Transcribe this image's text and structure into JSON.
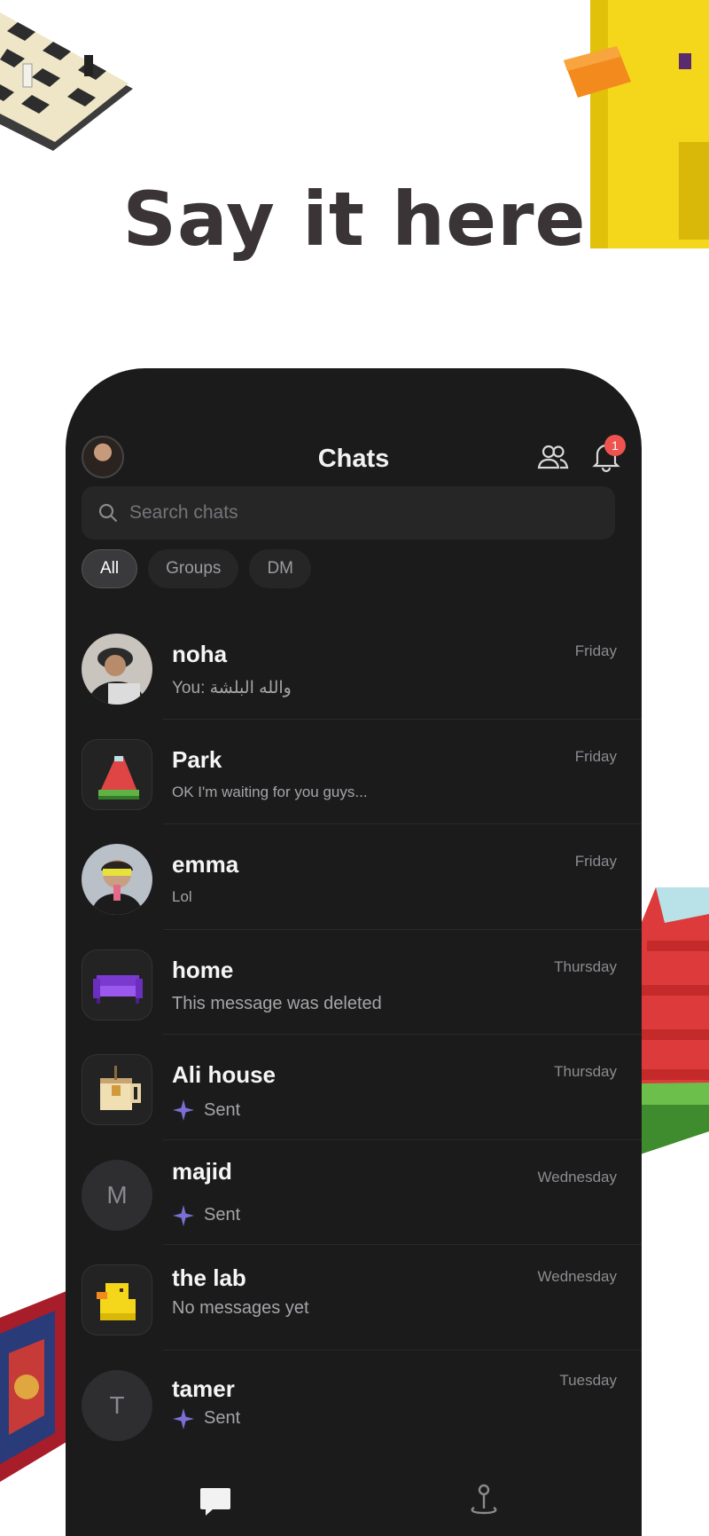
{
  "hero": {
    "title": "Say it here"
  },
  "header": {
    "title": "Chats",
    "notification_count": "1"
  },
  "search": {
    "placeholder": "Search chats"
  },
  "filters": [
    {
      "label": "All",
      "active": true
    },
    {
      "label": "Groups",
      "active": false
    },
    {
      "label": "DM",
      "active": false
    }
  ],
  "chats": [
    {
      "name": "noha",
      "time": "Friday",
      "preview": "You: والله البلشة",
      "avatar": "photo-man-cap",
      "sparkle": false
    },
    {
      "name": "Park",
      "time": "Friday",
      "preview": "OK I'm waiting for you guys...",
      "avatar": "watermelon-icon",
      "sparkle": false
    },
    {
      "name": "emma",
      "time": "Friday",
      "preview": "Lol",
      "avatar": "photo-woman-glasses",
      "sparkle": false
    },
    {
      "name": "home",
      "time": "Thursday",
      "preview": "This message was deleted",
      "avatar": "sofa-icon",
      "sparkle": false
    },
    {
      "name": "Ali house",
      "time": "Thursday",
      "preview": "Sent",
      "avatar": "tea-cup-icon",
      "sparkle": true
    },
    {
      "name": "majid",
      "time": "Wednesday",
      "preview": "Sent",
      "avatar": "M",
      "sparkle": true
    },
    {
      "name": "the lab",
      "time": "Wednesday",
      "preview": "No messages yet",
      "avatar": "duck-icon",
      "sparkle": false
    },
    {
      "name": "tamer",
      "time": "Tuesday",
      "preview": "Sent",
      "avatar": "T",
      "sparkle": true
    }
  ],
  "colors": {
    "background": "#1b1b1c",
    "accent_sparkle": "#7b6fd6",
    "badge": "#ef5350"
  }
}
